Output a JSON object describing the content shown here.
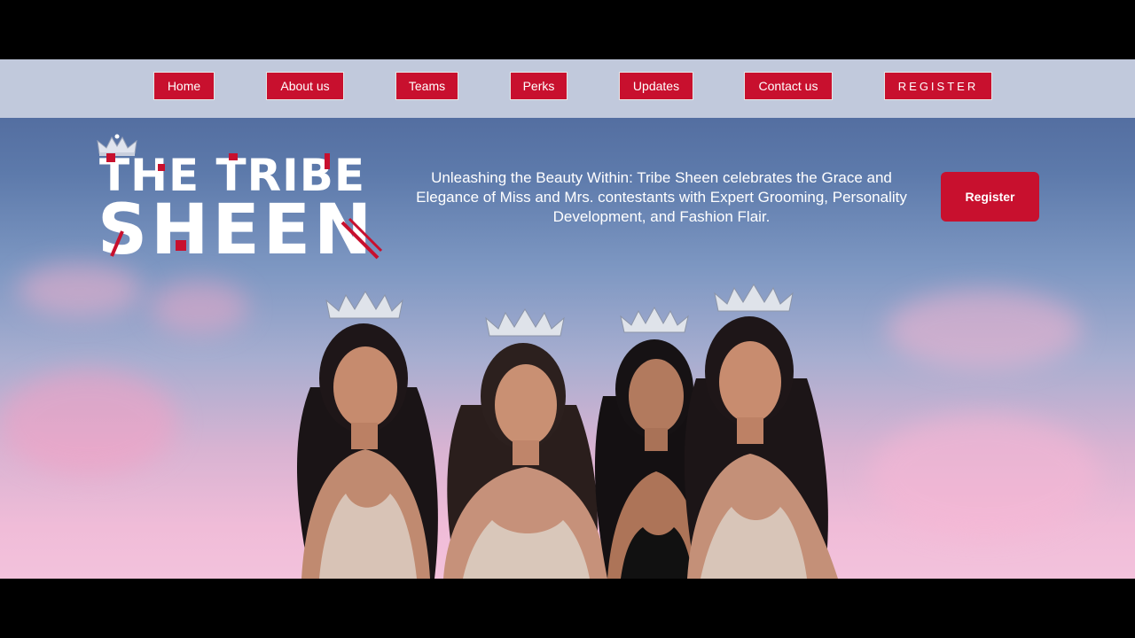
{
  "nav": {
    "items": [
      {
        "label": "Home"
      },
      {
        "label": "About us"
      },
      {
        "label": "Teams"
      },
      {
        "label": "Perks"
      },
      {
        "label": "Updates"
      },
      {
        "label": "Contact us"
      },
      {
        "label": "REGISTER"
      }
    ]
  },
  "brand": {
    "line1": "THE TRIBE",
    "line2": "SHEEN"
  },
  "hero": {
    "tagline": "Unleashing the Beauty Within: Tribe Sheen celebrates the Grace and Elegance of Miss and Mrs. contestants with Expert Grooming, Personality Development, and Fashion Flair.",
    "register_label": "Register"
  },
  "colors": {
    "accent": "#c8102e",
    "navbar": "#c1c9dc"
  }
}
